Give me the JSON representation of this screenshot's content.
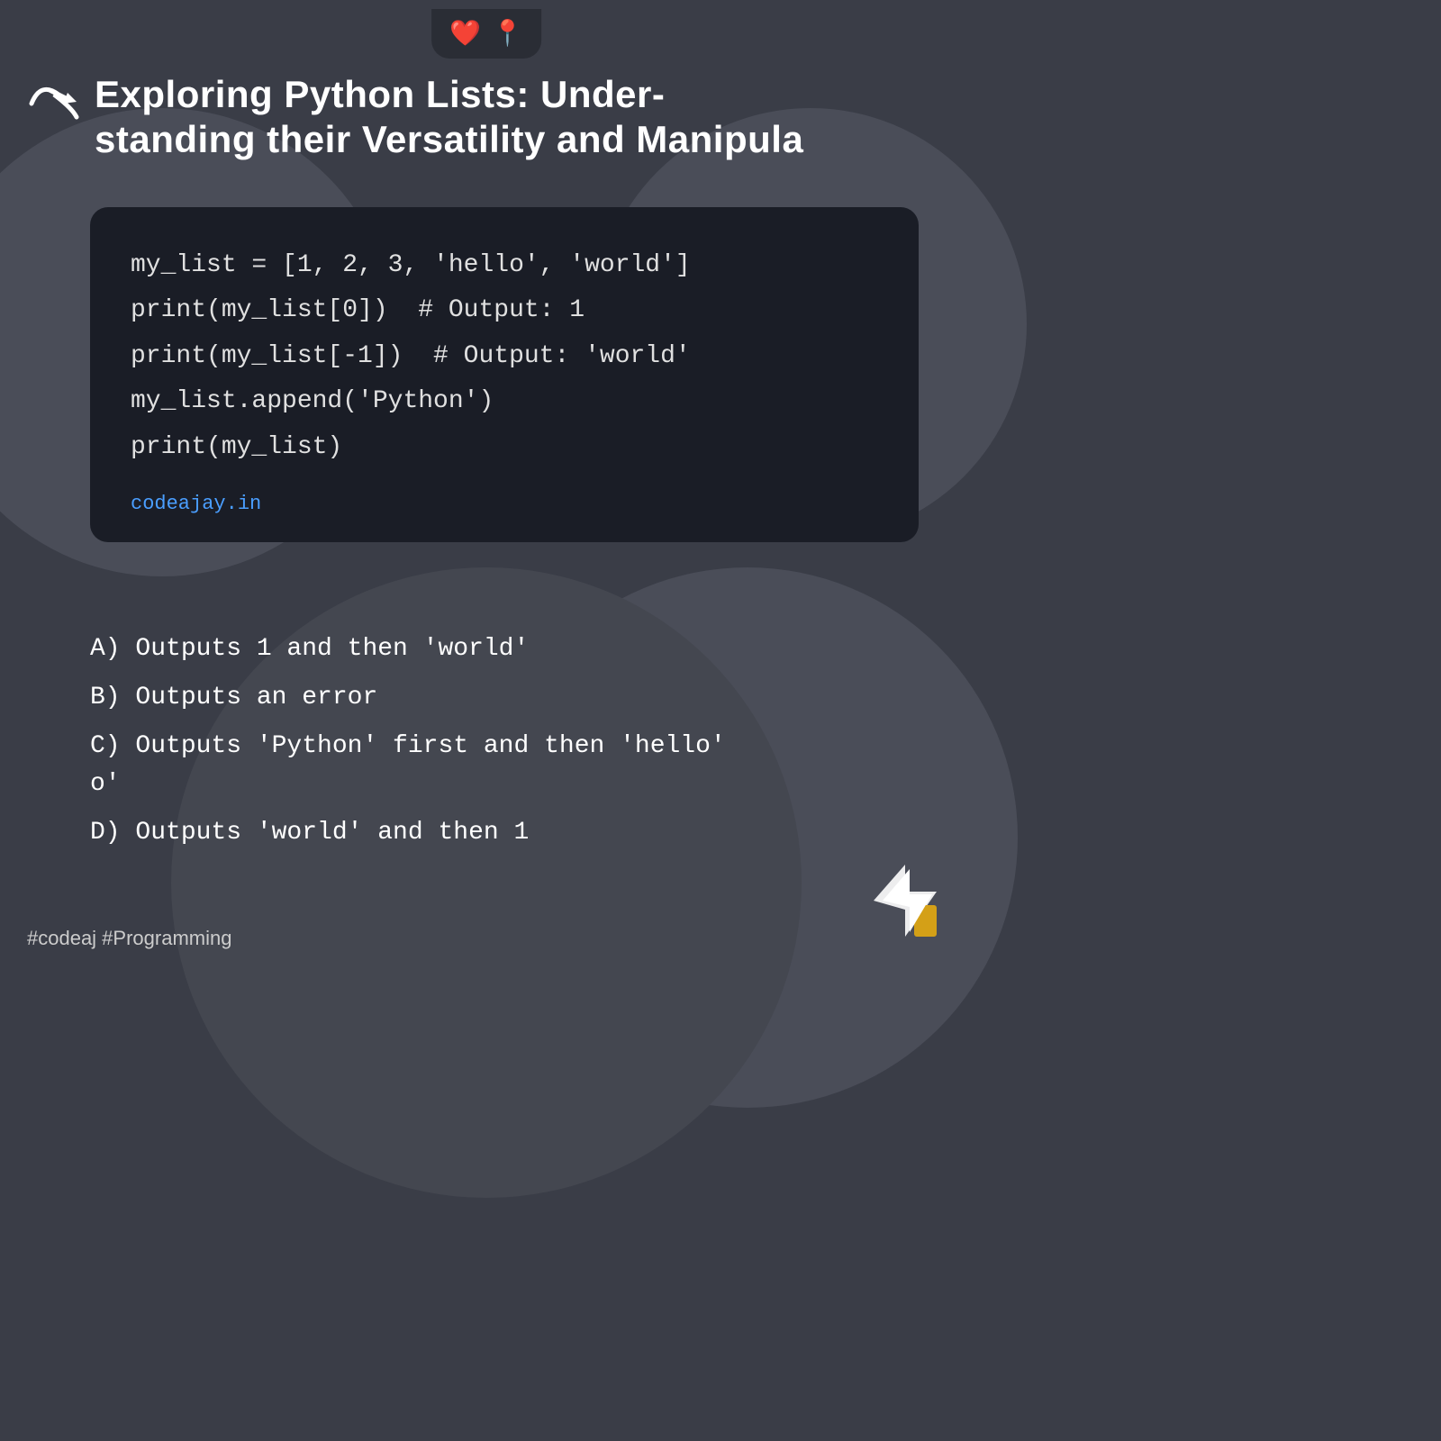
{
  "top_icons": {
    "heart": "❤️",
    "pin": "📍"
  },
  "header": {
    "title": "Exploring Python Lists: Understanding their Versatility and Manipu…",
    "title_line1": "Exploring Python Lists: Under-",
    "title_line2": "standing their Versatility and Manipula"
  },
  "code": {
    "lines": [
      "my_list = [1, 2, 3, 'hello', 'world']",
      "print(my_list[0])  # Output: 1",
      "print(my_list[-1])  # Output: 'world'",
      "my_list.append('Python')",
      "print(my_list)"
    ],
    "website": "codeajay.in"
  },
  "answers": {
    "a": "A)  Outputs 1 and then 'world'",
    "b": "B)  Outputs an error",
    "c": "C)  Outputs 'Python' first and then 'hello'\n    o'",
    "c_line1": "C)  Outputs 'Python' first and then 'hello'",
    "c_line2": "    o'",
    "d": "D)  Outputs 'world' and then 1"
  },
  "hashtags": "#codeaj #Programming",
  "colors": {
    "background": "#3a3d47",
    "code_bg": "#1a1d26",
    "accent_blue": "#4a9eff",
    "text_white": "#ffffff",
    "circle_dark": "#4a4d58"
  }
}
